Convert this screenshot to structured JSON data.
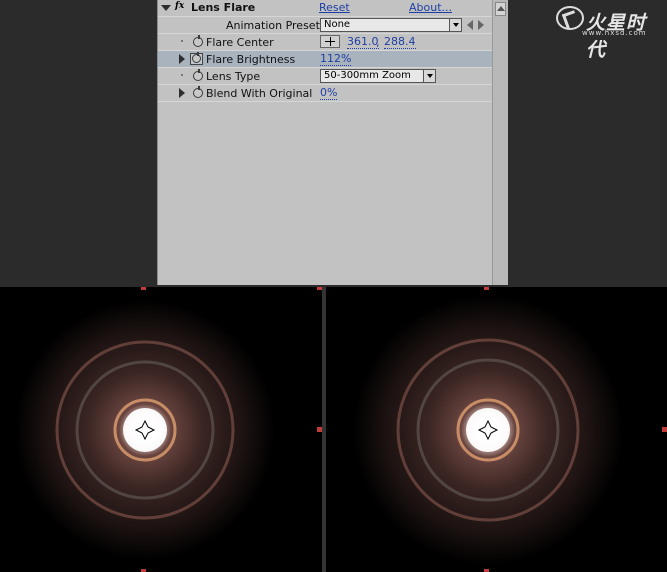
{
  "effect_panel": {
    "effect_name": "Lens Flare",
    "reset_label": "Reset",
    "about_label": "About...",
    "presets_label": "Animation Presets:",
    "presets_value": "None",
    "properties": [
      {
        "name": "Flare Center",
        "value_x": "361.0",
        "value_sep": ",",
        "value_y": "288.4"
      },
      {
        "name": "Flare Brightness",
        "value": "112",
        "unit": "%"
      },
      {
        "name": "Lens Type",
        "value": "50-300mm Zoom"
      },
      {
        "name": "Blend With Original",
        "value": "0",
        "unit": "%"
      }
    ]
  },
  "logo": {
    "text": "火星时代",
    "url": "www.hxsd.com"
  },
  "colors": {
    "panel_bg": "#c2c2c2",
    "selected_row": "#a9b3be",
    "value_blue": "#1e3fa4",
    "workspace_bg": "#2b2b2b",
    "viewer_bg": "#000000",
    "handle_red": "#c23b3b"
  },
  "icons": [
    "fx-icon",
    "disclosure-triangle-icon",
    "stopwatch-icon",
    "crosshair-icon",
    "dropdown-arrow-icon",
    "prev-preset-icon",
    "next-preset-icon",
    "scroll-up-icon"
  ]
}
